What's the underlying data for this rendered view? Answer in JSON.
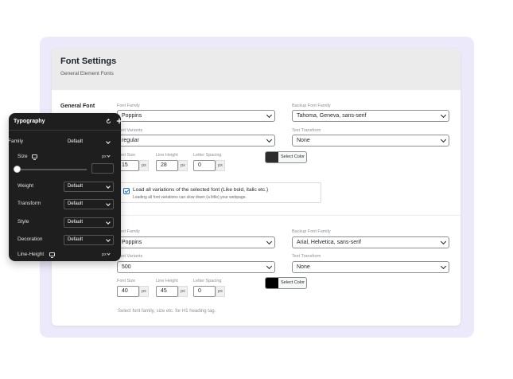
{
  "header": {
    "title": "Font Settings",
    "subtitle": "General Element Fonts"
  },
  "section": {
    "label": "General Font"
  },
  "general": {
    "font_family_label": "Font Family",
    "font_family": "Poppins",
    "backup_label": "Backup Font Family",
    "backup": "Tahoma, Geneva, sans-serif",
    "variants_label": "Font Variants",
    "variant": "regular",
    "transform_label": "Text Transform",
    "transform": "None",
    "size_label": "Font Size",
    "size": "15",
    "line_height_label": "Line Height",
    "line_height": "28",
    "letter_spacing_label": "Letter Spacing",
    "letter_spacing": "0",
    "unit": "px",
    "color_label": "Select Color",
    "color": "#2c2c2c",
    "load_all_label": "Load all variations of the selected font (Like bold, italic etc.)",
    "load_all_help": "Loading all font variations can slow down (a little) your webpage."
  },
  "heading": {
    "font_family_label": "Font Family",
    "font_family": "Poppins",
    "backup_label": "Backup Font Family",
    "backup": "Arial, Helvetica, sans-serif",
    "variants_label": "Font Variants",
    "variant": "500",
    "transform_label": "Text Transform",
    "transform": "None",
    "size_label": "Font Size",
    "size": "40",
    "line_height_label": "Line Height",
    "line_height": "45",
    "letter_spacing_label": "Letter Spacing",
    "letter_spacing": "0",
    "unit": "px",
    "color_label": "Select Color",
    "color": "#000000",
    "help": "Select font family, size etc. for H1 heading tag."
  },
  "panel": {
    "title": "Typography",
    "family_label": "Family",
    "family": "Default",
    "size_label": "Size",
    "size_unit": "px",
    "weight_label": "Weight",
    "weight": "Default",
    "transform_label": "Transform",
    "transform": "Default",
    "style_label": "Style",
    "style": "Default",
    "decoration_label": "Decoration",
    "decoration": "Default",
    "line_height_label": "Line-Height",
    "line_height_unit": "px"
  },
  "icons": {
    "reset": "reset-icon",
    "add": "plus-icon",
    "responsive": "monitor-icon"
  }
}
